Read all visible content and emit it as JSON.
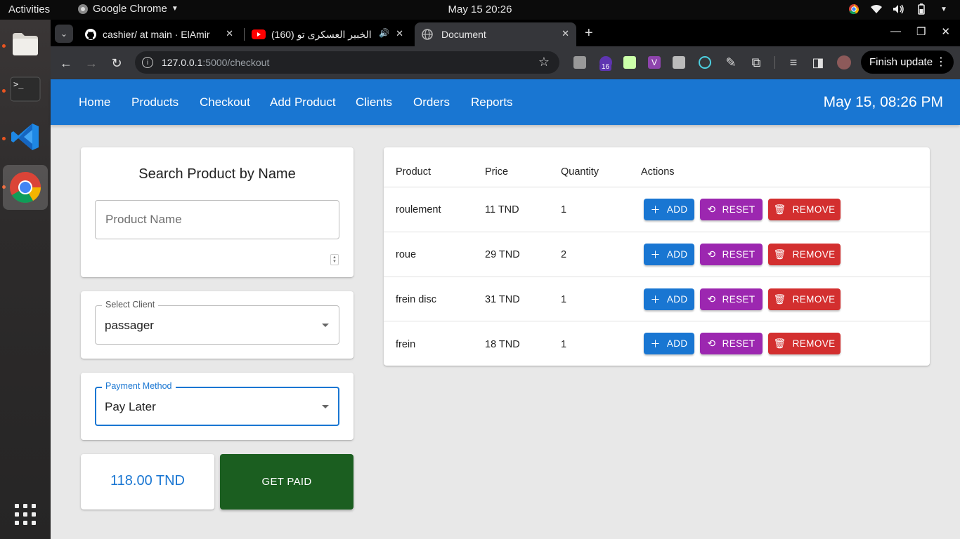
{
  "os": {
    "activities": "Activities",
    "app_menu": "Google Chrome",
    "clock": "May 15  20:26"
  },
  "browser": {
    "tabs": [
      {
        "title": "cashier/ at main · ElAmir",
        "icon": "github-icon"
      },
      {
        "title": "(160) الخبير العسكرى تو",
        "icon": "youtube-icon"
      },
      {
        "title": "Document",
        "icon": "globe-icon"
      }
    ],
    "url_host": "127.0.0.1",
    "url_path": ":5000/checkout",
    "extension_badge": "16",
    "finish_update": "Finish update"
  },
  "nav": {
    "links": [
      "Home",
      "Products",
      "Checkout",
      "Add Product",
      "Clients",
      "Orders",
      "Reports"
    ],
    "datetime": "May 15, 08:26 PM"
  },
  "search": {
    "title": "Search Product by Name",
    "placeholder": "Product Name"
  },
  "client_select": {
    "label": "Select Client",
    "value": "passager"
  },
  "payment_select": {
    "label": "Payment Method",
    "value": "Pay Later"
  },
  "total": "118.00 TND",
  "get_paid": "GET PAID",
  "cart": {
    "headers": [
      "Product",
      "Price",
      "Quantity",
      "Actions"
    ],
    "rows": [
      {
        "product": "roulement",
        "price": "11 TND",
        "quantity": "1"
      },
      {
        "product": "roue",
        "price": "29 TND",
        "quantity": "2"
      },
      {
        "product": "frein disc",
        "price": "31 TND",
        "quantity": "1"
      },
      {
        "product": "frein",
        "price": "18 TND",
        "quantity": "1"
      }
    ],
    "actions": {
      "add": "ADD",
      "reset": "RESET",
      "remove": "REMOVE"
    }
  },
  "colors": {
    "primary": "#1976d2",
    "reset": "#9c27b0",
    "remove": "#d32f2f",
    "get_paid": "#1b5e20"
  }
}
